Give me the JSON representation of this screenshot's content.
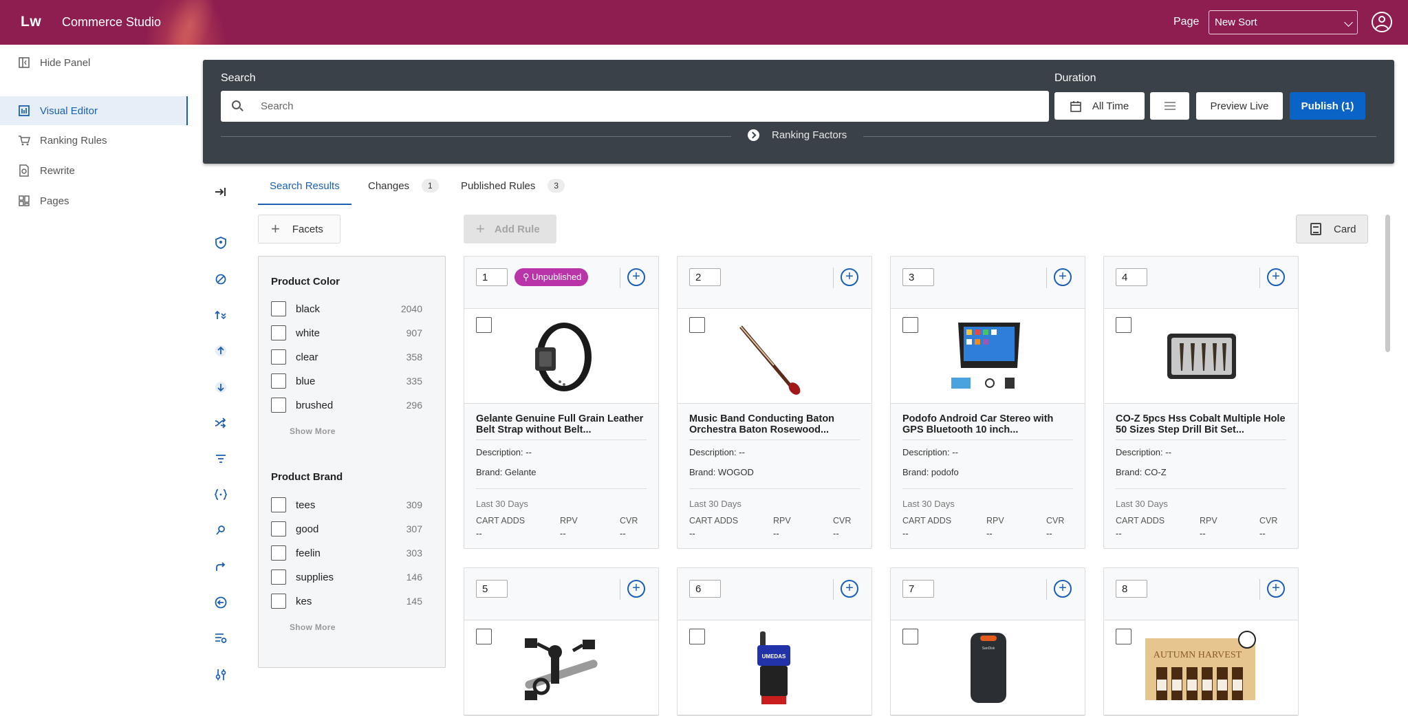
{
  "header": {
    "logo": "Lw",
    "app_title": "Commerce Studio",
    "page_label": "Page",
    "page_select_value": "New Sort"
  },
  "sidebar": {
    "hide_panel": "Hide Panel",
    "items": [
      {
        "label": "Visual Editor",
        "icon": "visual-editor-icon",
        "active": true
      },
      {
        "label": "Ranking Rules",
        "icon": "cart-icon",
        "active": false
      },
      {
        "label": "Rewrite",
        "icon": "rewrite-icon",
        "active": false
      },
      {
        "label": "Pages",
        "icon": "pages-icon",
        "active": false
      }
    ]
  },
  "search_panel": {
    "search_label": "Search",
    "search_placeholder": "Search",
    "duration_label": "Duration",
    "duration_value": "All Time",
    "preview_live": "Preview Live",
    "publish": "Publish (1)",
    "ranking_factors": "Ranking Factors"
  },
  "tabs": [
    {
      "label": "Search Results",
      "badge": null,
      "active": true
    },
    {
      "label": "Changes",
      "badge": "1",
      "active": false
    },
    {
      "label": "Published Rules",
      "badge": "3",
      "active": false
    }
  ],
  "toolbar": {
    "facets": "Facets",
    "add_rule": "Add Rule",
    "card": "Card"
  },
  "facets": [
    {
      "title": "Product Color",
      "options": [
        {
          "label": "black",
          "count": "2040"
        },
        {
          "label": "white",
          "count": "907"
        },
        {
          "label": "clear",
          "count": "358"
        },
        {
          "label": "blue",
          "count": "335"
        },
        {
          "label": "brushed",
          "count": "296"
        }
      ],
      "show_more": "Show More"
    },
    {
      "title": "Product Brand",
      "options": [
        {
          "label": "tees",
          "count": "309"
        },
        {
          "label": "good",
          "count": "307"
        },
        {
          "label": "feelin",
          "count": "303"
        },
        {
          "label": "supplies",
          "count": "146"
        },
        {
          "label": "kes",
          "count": "145"
        }
      ],
      "show_more": "Show More"
    }
  ],
  "products": [
    {
      "rank": "1",
      "status": "Unpublished",
      "title": "Gelante Genuine Full Grain Leather Belt Strap without Belt...",
      "description": "Description: --",
      "brand": "Brand: Gelante",
      "period": "Last 30 Days",
      "metrics": [
        {
          "label": "CART ADDS",
          "value": "--"
        },
        {
          "label": "RPV",
          "value": "--"
        },
        {
          "label": "CVR",
          "value": "--"
        }
      ],
      "image": "belt"
    },
    {
      "rank": "2",
      "status": "",
      "title": "Music Band Conducting Baton Orchestra Baton Rosewood...",
      "description": "Description: --",
      "brand": "Brand: WOGOD",
      "period": "Last 30 Days",
      "metrics": [
        {
          "label": "CART ADDS",
          "value": "--"
        },
        {
          "label": "RPV",
          "value": "--"
        },
        {
          "label": "CVR",
          "value": "--"
        }
      ],
      "image": "baton"
    },
    {
      "rank": "3",
      "status": "",
      "title": "Podofo Android Car Stereo with GPS Bluetooth 10 inch...",
      "description": "Description: --",
      "brand": "Brand: podofo",
      "period": "Last 30 Days",
      "metrics": [
        {
          "label": "CART ADDS",
          "value": "--"
        },
        {
          "label": "RPV",
          "value": "--"
        },
        {
          "label": "CVR",
          "value": "--"
        }
      ],
      "image": "stereo"
    },
    {
      "rank": "4",
      "status": "",
      "title": "CO-Z 5pcs Hss Cobalt Multiple Hole 50 Sizes Step Drill Bit Set...",
      "description": "Description: --",
      "brand": "Brand: CO-Z",
      "period": "Last 30 Days",
      "metrics": [
        {
          "label": "CART ADDS",
          "value": "--"
        },
        {
          "label": "RPV",
          "value": "--"
        },
        {
          "label": "CVR",
          "value": "--"
        }
      ],
      "image": "drill"
    },
    {
      "rank": "5",
      "image": "mount"
    },
    {
      "rank": "6",
      "image": "pump",
      "image_text": "UMEDAS"
    },
    {
      "rank": "7",
      "image": "ssd",
      "image_text": "SanDisk"
    },
    {
      "rank": "8",
      "image": "oils",
      "image_text": "AUTUMN HARVEST"
    }
  ],
  "colors": {
    "header_bg": "#8f1e50",
    "panel_bg": "#3a4148",
    "accent": "#1a5fb4",
    "publish_bg": "#0a64c8",
    "unpublished_badge": "#b934a8"
  }
}
